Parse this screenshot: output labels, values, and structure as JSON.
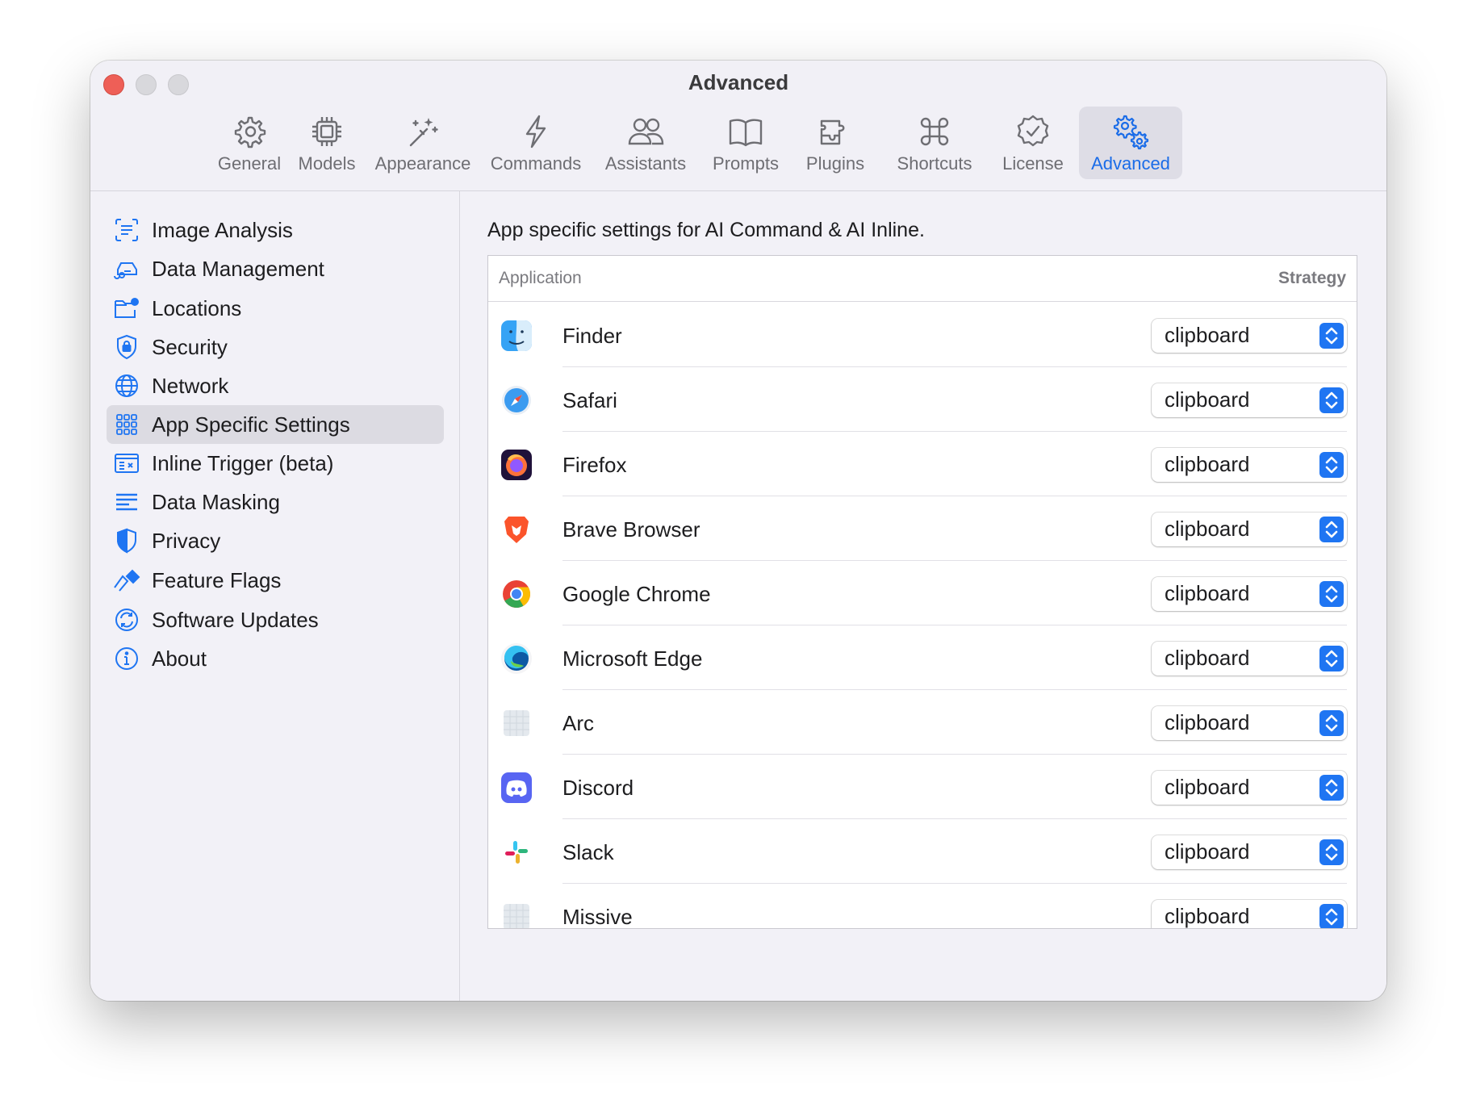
{
  "window": {
    "title": "Advanced"
  },
  "toolbar": {
    "tabs": [
      {
        "id": "general",
        "label": "General",
        "icon": "gear-icon",
        "active": false
      },
      {
        "id": "models",
        "label": "Models",
        "icon": "chip-icon",
        "active": false
      },
      {
        "id": "appearance",
        "label": "Appearance",
        "icon": "magic-wand-icon",
        "active": false
      },
      {
        "id": "commands",
        "label": "Commands",
        "icon": "bolt-icon",
        "active": false
      },
      {
        "id": "assistants",
        "label": "Assistants",
        "icon": "people-icon",
        "active": false
      },
      {
        "id": "prompts",
        "label": "Prompts",
        "icon": "book-icon",
        "active": false
      },
      {
        "id": "plugins",
        "label": "Plugins",
        "icon": "puzzle-icon",
        "active": false
      },
      {
        "id": "shortcuts",
        "label": "Shortcuts",
        "icon": "command-key-icon",
        "active": false
      },
      {
        "id": "license",
        "label": "License",
        "icon": "checkmark-seal-icon",
        "active": false
      },
      {
        "id": "advanced",
        "label": "Advanced",
        "icon": "gears-icon",
        "active": true
      }
    ]
  },
  "sidebar": {
    "items": [
      {
        "label": "Image Analysis",
        "icon": "text-viewfinder-icon",
        "selected": false
      },
      {
        "label": "Data Management",
        "icon": "car-storage-icon",
        "selected": false
      },
      {
        "label": "Locations",
        "icon": "folder-gear-icon",
        "selected": false
      },
      {
        "label": "Security",
        "icon": "lock-shield-icon",
        "selected": false
      },
      {
        "label": "Network",
        "icon": "globe-icon",
        "selected": false
      },
      {
        "label": "App Specific Settings",
        "icon": "app-grid-icon",
        "selected": true
      },
      {
        "label": "Inline Trigger (beta)",
        "icon": "keyboard-window-icon",
        "selected": false
      },
      {
        "label": "Data Masking",
        "icon": "text-lines-icon",
        "selected": false
      },
      {
        "label": "Privacy",
        "icon": "half-shield-icon",
        "selected": false
      },
      {
        "label": "Feature Flags",
        "icon": "flags-icon",
        "selected": false
      },
      {
        "label": "Software Updates",
        "icon": "refresh-icon",
        "selected": false
      },
      {
        "label": "About",
        "icon": "info-icon",
        "selected": false
      }
    ]
  },
  "main": {
    "description": "App specific settings for AI Command & AI Inline.",
    "table": {
      "columns": {
        "application": "Application",
        "strategy": "Strategy"
      },
      "rows": [
        {
          "app": "Finder",
          "icon": "finder-icon",
          "strategy": "clipboard"
        },
        {
          "app": "Safari",
          "icon": "safari-icon",
          "strategy": "clipboard"
        },
        {
          "app": "Firefox",
          "icon": "firefox-icon",
          "strategy": "clipboard"
        },
        {
          "app": "Brave Browser",
          "icon": "brave-icon",
          "strategy": "clipboard"
        },
        {
          "app": "Google Chrome",
          "icon": "chrome-icon",
          "strategy": "clipboard"
        },
        {
          "app": "Microsoft Edge",
          "icon": "edge-icon",
          "strategy": "clipboard"
        },
        {
          "app": "Arc",
          "icon": "generic-app-icon",
          "strategy": "clipboard"
        },
        {
          "app": "Discord",
          "icon": "discord-icon",
          "strategy": "clipboard"
        },
        {
          "app": "Slack",
          "icon": "slack-icon",
          "strategy": "clipboard"
        },
        {
          "app": "Missive",
          "icon": "generic-app-icon",
          "strategy": "clipboard"
        }
      ]
    },
    "buttons": {
      "add": "plus-icon",
      "remove": "minus-icon"
    }
  },
  "colors": {
    "accent": "#1f75f2",
    "close": "#ee5f57",
    "selection": "#dcdbe2"
  }
}
